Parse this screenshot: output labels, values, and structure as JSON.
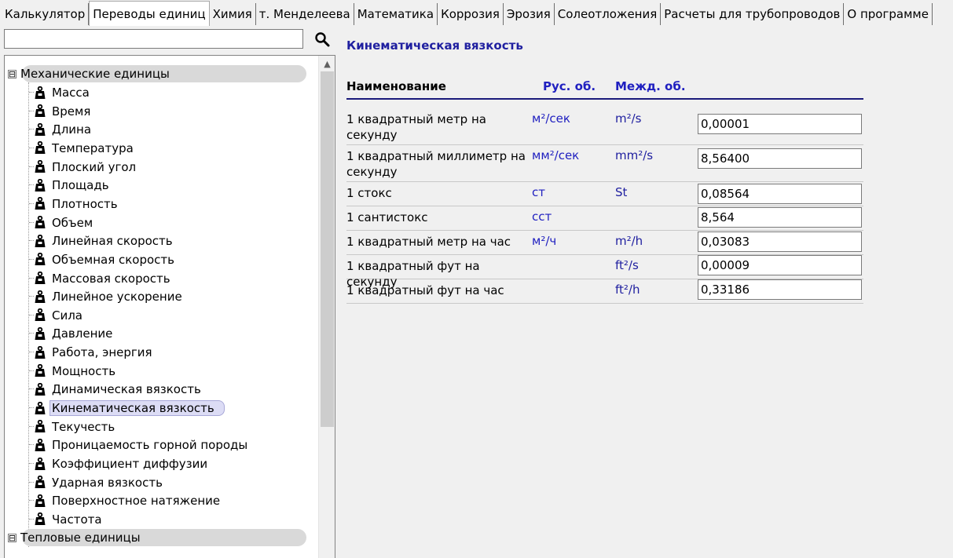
{
  "tabs": [
    {
      "label": "Калькулятор",
      "active": false
    },
    {
      "label": "Переводы единиц",
      "active": true
    },
    {
      "label": "Химия",
      "active": false
    },
    {
      "label": "т. Менделеева",
      "active": false
    },
    {
      "label": "Математика",
      "active": false
    },
    {
      "label": "Коррозия",
      "active": false
    },
    {
      "label": "Эрозия",
      "active": false
    },
    {
      "label": "Солеотложения",
      "active": false
    },
    {
      "label": "Расчеты для трубопроводов",
      "active": false
    },
    {
      "label": "О программе",
      "active": false
    }
  ],
  "search": {
    "value": "",
    "placeholder": ""
  },
  "tree": {
    "categories": [
      {
        "label": "Механические единицы",
        "expander": "⊟"
      },
      {
        "label": "Тепловые единицы",
        "expander": "⊟"
      }
    ],
    "items": [
      "Масса",
      "Время",
      "Длина",
      "Температура",
      "Плоский угол",
      "Площадь",
      "Плотность",
      "Объем",
      "Линейная скорость",
      "Объемная скорость",
      "Массовая скорость",
      "Линейное ускорение",
      "Сила",
      "Давление",
      "Работа, энергия",
      "Мощность",
      "Динамическая вязкость",
      "Кинематическая вязкость",
      "Текучесть",
      "Проницаемость горной породы",
      "Коэффициент диффузии",
      "Ударная вязкость",
      "Поверхностное натяжение",
      "Частота"
    ],
    "selected_index": 17
  },
  "panel": {
    "title": "Кинематическая вязкость",
    "headers": {
      "name": "Наименование",
      "rus": "Рус. об.",
      "intl": "Межд. об."
    },
    "rows": [
      {
        "name": "1 квадратный метр на секунду",
        "rus": "м²/сек",
        "intl": "m²/s",
        "value": "0,00001"
      },
      {
        "name": "1 квадратный миллиметр на секунду",
        "rus": "мм²/сек",
        "intl": "mm²/s",
        "value": "8,56400"
      },
      {
        "name": "1 стокс",
        "rus": "ст",
        "intl": "St",
        "value": "0,08564"
      },
      {
        "name": "1 сантистокс",
        "rus": "сст",
        "intl": "",
        "value": "8,564"
      },
      {
        "name": "1 квадратный метр на час",
        "rus": "м²/ч",
        "intl": "m²/h",
        "value": "0,03083"
      },
      {
        "name": "1 квадратный фут на секунду",
        "rus": "",
        "intl": "ft²/s",
        "value": "0,00009"
      },
      {
        "name": "1 квадратный фут на час",
        "rus": "",
        "intl": "ft²/h",
        "value": "0,33186"
      }
    ]
  }
}
